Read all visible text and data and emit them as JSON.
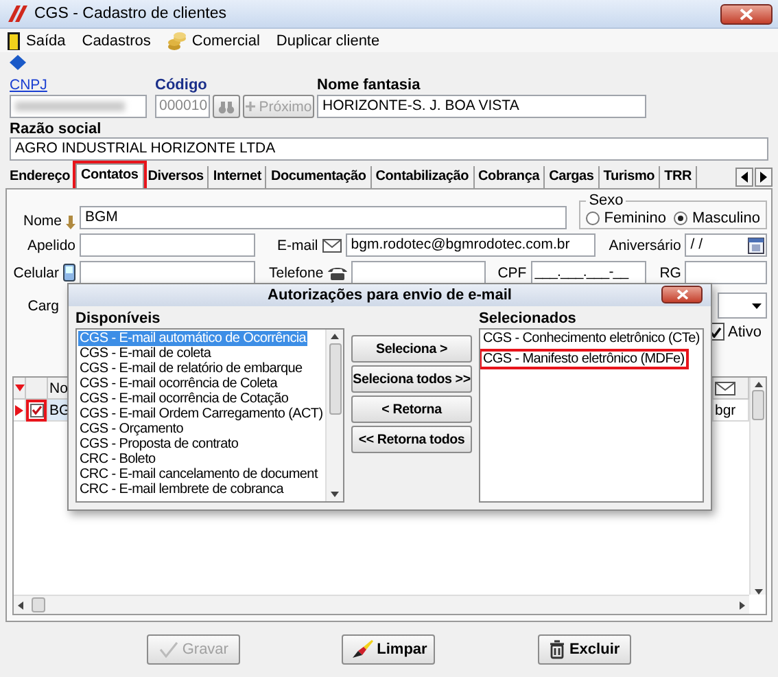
{
  "window": {
    "title": "CGS - Cadastro de clientes"
  },
  "menu": [
    {
      "label": "Saída",
      "kind": "exit"
    },
    {
      "label": "Cadastros",
      "kind": "plain"
    },
    {
      "label": "Comercial",
      "kind": "coins"
    },
    {
      "label": "Duplicar cliente",
      "kind": "plain"
    }
  ],
  "header": {
    "cnpj_label": "CNPJ",
    "codigo_label": "Código",
    "codigo_value": "000010",
    "next_button": {
      "label": "Próximo",
      "disabled": true
    },
    "nome_fantasia_label": "Nome fantasia",
    "nome_fantasia_value": "HORIZONTE-S. J. BOA VISTA",
    "razao_social_label": "Razão social",
    "razao_social_value": "AGRO INDUSTRIAL HORIZONTE LTDA"
  },
  "tabs": [
    {
      "label": "Endereço",
      "selected": false,
      "highlighted": false
    },
    {
      "label": "Contatos",
      "selected": true,
      "highlighted": true
    },
    {
      "label": "Diversos",
      "selected": false,
      "highlighted": false
    },
    {
      "label": "Internet",
      "selected": false,
      "highlighted": false
    },
    {
      "label": "Documentação",
      "selected": false,
      "highlighted": false
    },
    {
      "label": "Contabilização",
      "selected": false,
      "highlighted": false
    },
    {
      "label": "Cobrança",
      "selected": false,
      "highlighted": false
    },
    {
      "label": "Cargas",
      "selected": false,
      "highlighted": false
    },
    {
      "label": "Turismo",
      "selected": false,
      "highlighted": false
    },
    {
      "label": "TRR",
      "selected": false,
      "highlighted": false
    }
  ],
  "contact": {
    "nome": {
      "label": "Nome",
      "value": "BGM"
    },
    "sexo": {
      "label": "Sexo",
      "options": [
        {
          "label": "Feminino",
          "selected": false
        },
        {
          "label": "Masculino",
          "selected": true
        }
      ]
    },
    "apelido": {
      "label": "Apelido"
    },
    "email": {
      "label": "E-mail",
      "value": "bgm.rodotec@bgmrodotec.com.br"
    },
    "aniversario": {
      "label": "Aniversário",
      "value": "/ /"
    },
    "celular": {
      "label": "Celular"
    },
    "telefone": {
      "label": "Telefone"
    },
    "cpf": {
      "label": "CPF",
      "value": "___.___.___-__"
    },
    "rg": {
      "label": "RG"
    },
    "cargo": {
      "label": "Carg"
    },
    "ativo": {
      "label": "Ativo",
      "checked": true
    }
  },
  "grid": {
    "column_1": "No",
    "rows": [
      {
        "checked": true,
        "highlighted": true,
        "cell_1": "BG",
        "cell_2": "bgr"
      }
    ]
  },
  "dialog": {
    "title": "Autorizações para envio de e-mail",
    "available": {
      "label": "Disponíveis",
      "items": [
        {
          "label": "CGS - E-mail automático de Ocorrência",
          "selected": true
        },
        {
          "label": "CGS - E-mail de coleta",
          "selected": false
        },
        {
          "label": "CGS - E-mail de relatório de embarque",
          "selected": false
        },
        {
          "label": "CGS - E-mail ocorrência de Coleta",
          "selected": false
        },
        {
          "label": "CGS - E-mail ocorrência de Cotação",
          "selected": false
        },
        {
          "label": "CGS - E-mail Ordem Carregamento (ACT)",
          "selected": false
        },
        {
          "label": "CGS - Orçamento",
          "selected": false
        },
        {
          "label": "CGS - Proposta de contrato",
          "selected": false
        },
        {
          "label": "CRC - Boleto",
          "selected": false
        },
        {
          "label": "CRC - E-mail cancelamento de document",
          "selected": false
        },
        {
          "label": "CRC - E-mail lembrete de cobranca",
          "selected": false
        }
      ]
    },
    "buttons": [
      "Seleciona >",
      "Seleciona todos >>",
      "< Retorna",
      "<< Retorna todos"
    ],
    "chosen": {
      "label": "Selecionados",
      "items": [
        {
          "label": "CGS - Conhecimento eletrônico (CTe)",
          "highlighted": false
        },
        {
          "label": "CGS - Manifesto eletrônico (MDFe)",
          "highlighted": true
        }
      ]
    }
  },
  "footer": {
    "buttons": [
      {
        "label": "Gravar",
        "kind": "save",
        "disabled": true
      },
      {
        "label": "Limpar",
        "kind": "clear",
        "disabled": false
      },
      {
        "label": "Excluir",
        "kind": "delete",
        "disabled": false
      }
    ]
  }
}
